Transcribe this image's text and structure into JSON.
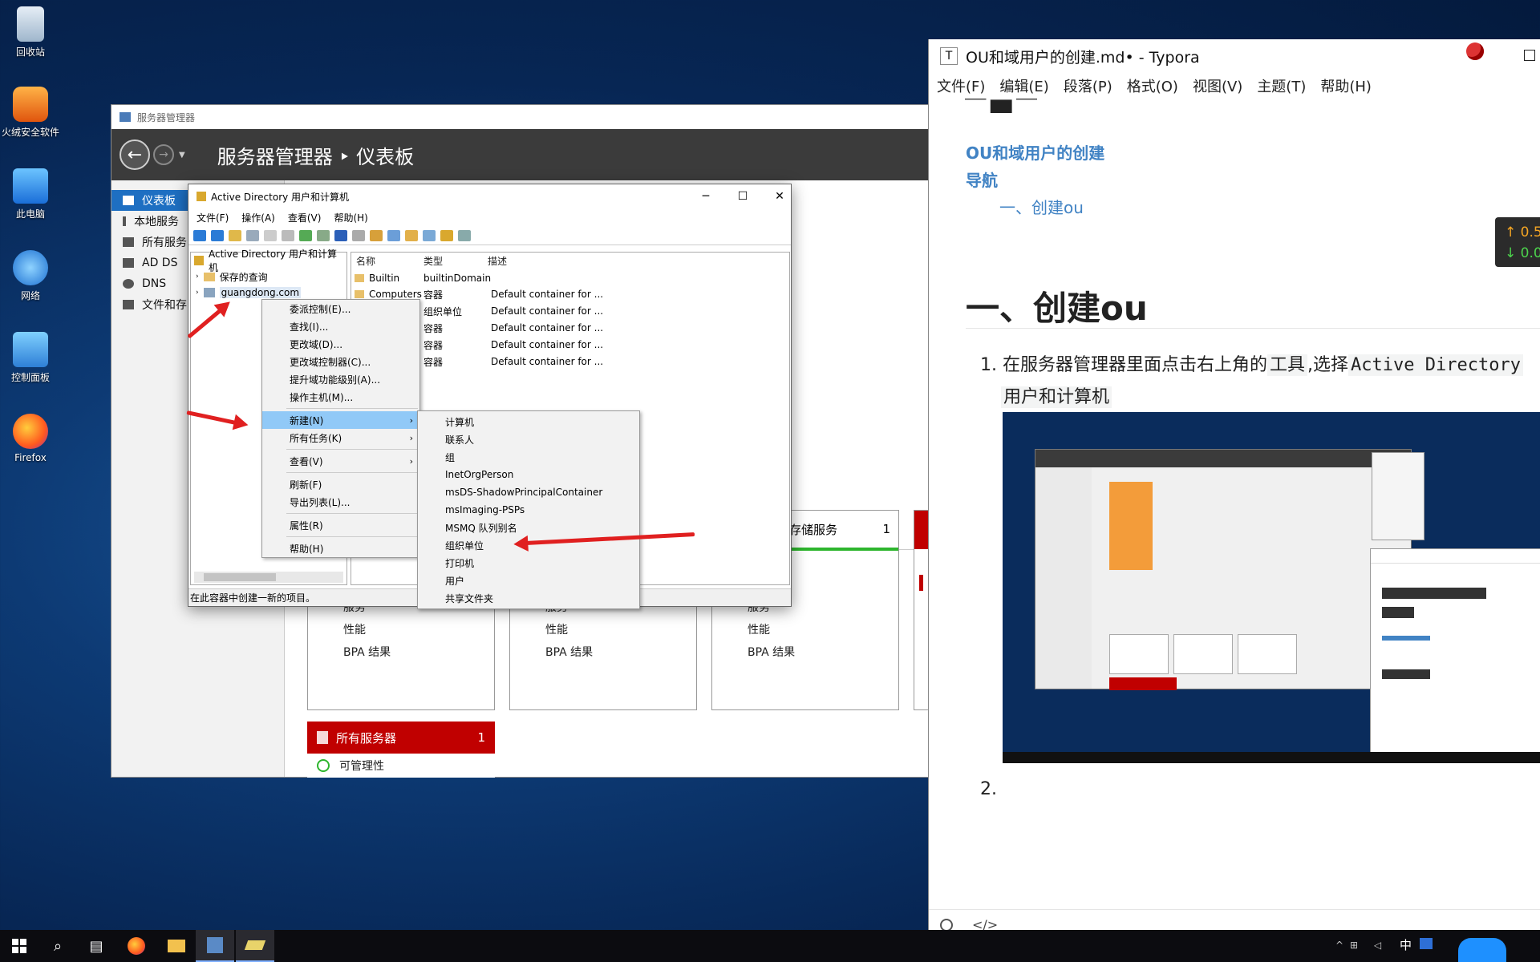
{
  "desktop": {
    "icons": [
      "回收站",
      "火绒安全软件",
      "此电脑",
      "网络",
      "控制面板",
      "Firefox"
    ]
  },
  "server_manager": {
    "title": "服务器管理器",
    "breadcrumb": "服务器管理器 ‣ 仪表板",
    "sidebar": [
      "仪表板",
      "本地服务",
      "所有服务",
      "AD DS",
      "DNS",
      "文件和存"
    ],
    "tiles": [
      {
        "lines": [
          "服务",
          "性能",
          "BPA 结果"
        ]
      },
      {
        "lines": [
          "服务",
          "性能",
          "BPA 结果"
        ]
      },
      {
        "title": "存储服务",
        "count": "1",
        "lines": [
          "服务",
          "性能",
          "BPA 结果"
        ]
      }
    ],
    "all_servers": {
      "label": "所有服务器",
      "count": "1",
      "sub": "可管理性"
    }
  },
  "ad_window": {
    "title": "Active Directory 用户和计算机",
    "menu": [
      "文件(F)",
      "操作(A)",
      "查看(V)",
      "帮助(H)"
    ],
    "tree": [
      "Active Directory 用户和计算机",
      "保存的查询",
      "guangdong.com"
    ],
    "columns": [
      "名称",
      "类型",
      "描述"
    ],
    "rows": [
      {
        "name": "Builtin",
        "type": "builtinDomain",
        "desc": ""
      },
      {
        "name": "Computers",
        "type": "容器",
        "desc": "Default container for ..."
      },
      {
        "name": "",
        "type": "组织单位",
        "desc": "Default container for ..."
      },
      {
        "name": "",
        "type": "容器",
        "desc": "Default container for ..."
      },
      {
        "name": "",
        "type": "容器",
        "desc": "Default container for ..."
      },
      {
        "name": "",
        "type": "容器",
        "desc": "Default container for ..."
      }
    ],
    "status": "在此容器中创建一新的项目。"
  },
  "context_menu": {
    "items": [
      "委派控制(E)...",
      "查找(I)...",
      "更改域(D)...",
      "更改域控制器(C)...",
      "提升域功能级别(A)...",
      "操作主机(M)..."
    ],
    "new": "新建(N)",
    "all_tasks": "所有任务(K)",
    "view": "查看(V)",
    "refresh": "刷新(F)",
    "export": "导出列表(L)...",
    "properties": "属性(R)",
    "help": "帮助(H)"
  },
  "submenu": [
    "计算机",
    "联系人",
    "组",
    "InetOrgPerson",
    "msDS-ShadowPrincipalContainer",
    "msImaging-PSPs",
    "MSMQ 队列别名",
    "组织单位",
    "打印机",
    "用户",
    "共享文件夹"
  ],
  "typora": {
    "title": "OU和域用户的创建.md• - Typora",
    "menu": [
      "文件(F)",
      "编辑(E)",
      "段落(P)",
      "格式(O)",
      "视图(V)",
      "主题(T)",
      "帮助(H)"
    ],
    "toc": [
      "OU和域用户的创建",
      "导航",
      "一、创建ou"
    ],
    "heading": "一、创建ou",
    "step1_a": "在服务器管理器里面点击右上角的",
    "step1_code1": "工具",
    "step1_b": ",选择",
    "step1_code2": "Active Directory",
    "step1_code3": "用户和计算机",
    "step2": "2.",
    "net_up": "↑ 0.5",
    "net_down": "↓ 0.0"
  },
  "taskbar": {
    "ime": "中"
  },
  "colors": {
    "accent": "#1e6fc2",
    "red": "#c00000",
    "link": "#4183c4"
  }
}
